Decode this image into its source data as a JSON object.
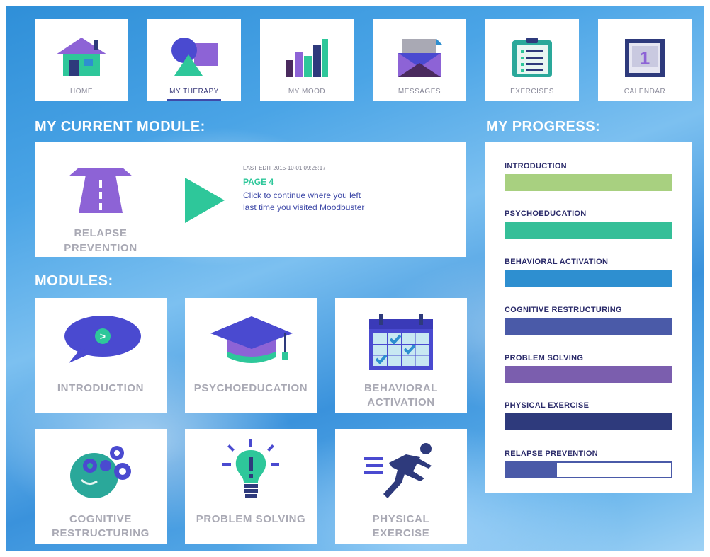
{
  "nav": {
    "items": [
      {
        "label": "HOME",
        "icon": "house-icon"
      },
      {
        "label": "MY THERAPY",
        "icon": "shapes-icon",
        "active": true
      },
      {
        "label": "MY MOOD",
        "icon": "bar-chart-icon"
      },
      {
        "label": "MESSAGES",
        "icon": "envelope-icon"
      },
      {
        "label": "EXERCISES",
        "icon": "clipboard-icon"
      },
      {
        "label": "CALENDAR",
        "icon": "calendar-icon"
      }
    ]
  },
  "current_module": {
    "heading": "MY CURRENT MODULE:",
    "name_line1": "RELAPSE",
    "name_line2": "PREVENTION",
    "last_edit": "LAST EDIT 2015-10-01 09:28:17",
    "page": "PAGE 4",
    "continue_line1": "Click to continue where you left",
    "continue_line2": "last time you visited Moodbuster"
  },
  "modules": {
    "heading": "MODULES:",
    "items": [
      {
        "line1": "INTRODUCTION",
        "line2": ""
      },
      {
        "line1": "PSYCHOEDUCATION",
        "line2": ""
      },
      {
        "line1": "BEHAVIORAL",
        "line2": "ACTIVATION"
      },
      {
        "line1": "COGNITIVE",
        "line2": "RESTRUCTURING"
      },
      {
        "line1": "PROBLEM SOLVING",
        "line2": ""
      },
      {
        "line1": "PHYSICAL",
        "line2": "EXERCISE"
      }
    ]
  },
  "progress": {
    "heading": "MY PROGRESS:",
    "items": [
      {
        "label": "INTRODUCTION",
        "color": "#a8d080",
        "fraction": 1.0
      },
      {
        "label": "PSYCHOEDUCATION",
        "color": "#35bf98",
        "fraction": 1.0
      },
      {
        "label": "BEHAVIORAL ACTIVATION",
        "color": "#2e8fd0",
        "fraction": 1.0
      },
      {
        "label": "COGNITIVE RESTRUCTURING",
        "color": "#4a5aa8",
        "fraction": 1.0
      },
      {
        "label": "PROBLEM SOLVING",
        "color": "#7b5eae",
        "fraction": 1.0
      },
      {
        "label": "PHYSICAL EXERCISE",
        "color": "#2e3a7c",
        "fraction": 1.0
      },
      {
        "label": "RELAPSE PREVENTION",
        "color": "#4a5aa8",
        "fraction": 0.31
      }
    ]
  },
  "colors": {
    "accent_teal": "#2ec79a",
    "purple": "#8d63d6",
    "navy": "#2e3a7c"
  }
}
